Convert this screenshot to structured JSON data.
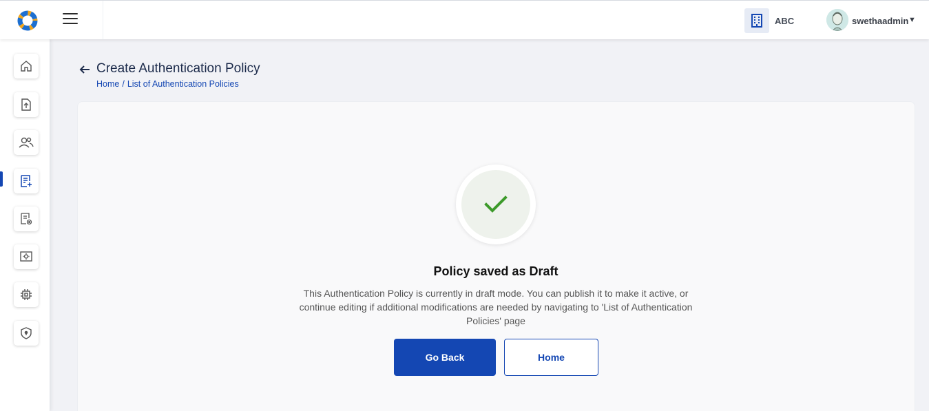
{
  "header": {
    "org_name": "ABC",
    "username": "swethaadmin",
    "icons": [
      "app-logo",
      "hamburger-menu-icon",
      "building-icon",
      "user-avatar",
      "dropdown-caret-icon"
    ]
  },
  "sidebar": {
    "items": [
      {
        "icon": "home-icon"
      },
      {
        "icon": "file-upload-icon"
      },
      {
        "icon": "users-icon"
      },
      {
        "icon": "policy-add-icon",
        "active": true
      },
      {
        "icon": "policy-settings-icon"
      },
      {
        "icon": "screen-settings-icon"
      },
      {
        "icon": "chip-icon"
      },
      {
        "icon": "shield-lock-icon"
      }
    ]
  },
  "page": {
    "title": "Create Authentication Policy",
    "breadcrumb": [
      "Home",
      "List of Authentication Policies"
    ],
    "breadcrumb_sep": "/"
  },
  "result": {
    "status_icon": "checkmark-icon",
    "title": "Policy saved as Draft",
    "message": "This Authentication Policy is currently in draft mode. You can publish it to make it active, or continue editing if additional modifications are needed by navigating to 'List of Authentication Policies' page",
    "primary_button": "Go Back",
    "secondary_button": "Home"
  },
  "colors": {
    "accent": "#1447b3",
    "success": "#3c9a2a",
    "background": "#f1f2f6"
  }
}
